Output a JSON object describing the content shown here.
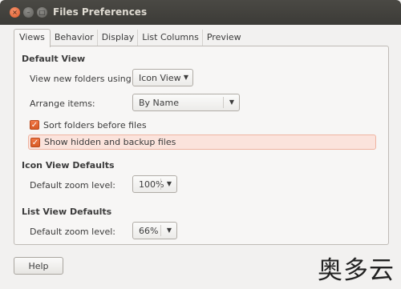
{
  "window": {
    "title": "Files Preferences",
    "close_glyph": "×",
    "minimize_glyph": "–",
    "maximize_glyph": "□"
  },
  "tabs": [
    {
      "label": "Views",
      "active": true
    },
    {
      "label": "Behavior",
      "active": false
    },
    {
      "label": "Display",
      "active": false
    },
    {
      "label": "List Columns",
      "active": false
    },
    {
      "label": "Preview",
      "active": false
    }
  ],
  "default_view": {
    "title": "Default View",
    "view_new_label": "View new folders using:",
    "view_new_value": "Icon View",
    "arrange_label": "Arrange items:",
    "arrange_value": "By Name",
    "sort_folders_label": "Sort folders before files",
    "sort_folders_checked": true,
    "show_hidden_label": "Show hidden and backup files",
    "show_hidden_checked": true
  },
  "icon_view": {
    "title": "Icon View Defaults",
    "zoom_label": "Default zoom level:",
    "zoom_value": "100%"
  },
  "list_view": {
    "title": "List View Defaults",
    "zoom_label": "Default zoom level:",
    "zoom_value": "66%"
  },
  "footer": {
    "help_label": "Help"
  },
  "watermark": {
    "text": "奥多云"
  },
  "colors": {
    "titlebar": "#3c3b37",
    "accent": "#e05a2a",
    "highlight_bg": "#fbe3dc"
  }
}
